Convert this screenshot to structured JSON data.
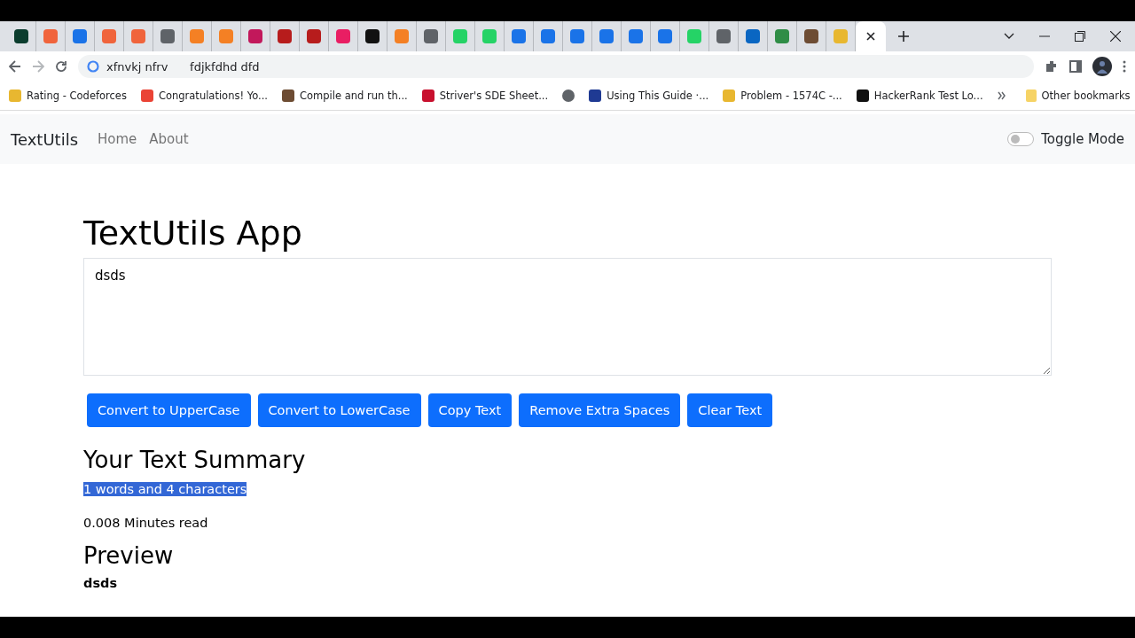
{
  "browser": {
    "tabs": [
      {
        "color": "#0b3d2e",
        "selected": false
      },
      {
        "color": "#f0643c",
        "selected": false
      },
      {
        "color": "#1a73e8",
        "selected": false
      },
      {
        "color": "#f0643c",
        "selected": false
      },
      {
        "color": "#f0643c",
        "selected": false
      },
      {
        "color": "#5f6368",
        "selected": false
      },
      {
        "color": "#f48024",
        "selected": false
      },
      {
        "color": "#f48024",
        "selected": false
      },
      {
        "color": "#c2185b",
        "selected": false
      },
      {
        "color": "#b71c1c",
        "selected": false
      },
      {
        "color": "#b71c1c",
        "selected": false
      },
      {
        "color": "#e91e63",
        "selected": false
      },
      {
        "color": "#111111",
        "selected": false
      },
      {
        "color": "#f48024",
        "selected": false
      },
      {
        "color": "#5f6368",
        "selected": false
      },
      {
        "color": "#25d366",
        "selected": false
      },
      {
        "color": "#25d366",
        "selected": false
      },
      {
        "color": "#1a73e8",
        "selected": false
      },
      {
        "color": "#1a73e8",
        "selected": false
      },
      {
        "color": "#1a73e8",
        "selected": false
      },
      {
        "color": "#1a73e8",
        "selected": false
      },
      {
        "color": "#1a73e8",
        "selected": false
      },
      {
        "color": "#1a73e8",
        "selected": false
      },
      {
        "color": "#25d366",
        "selected": false
      },
      {
        "color": "#5f6368",
        "selected": false
      },
      {
        "color": "#0a66c2",
        "selected": false
      },
      {
        "color": "#2f8d46",
        "selected": false
      },
      {
        "color": "#6d4c33",
        "selected": false
      },
      {
        "color": "#e8b730",
        "selected": false
      },
      {
        "selected": true
      }
    ],
    "address": "xfnvkj nfrv      fdjkfdhd dfd",
    "bookmarks": [
      {
        "label": "Rating - Codeforces",
        "color": "#e8b730"
      },
      {
        "label": "Congratulations! Yo...",
        "color": "#ea4335"
      },
      {
        "label": "Compile and run th...",
        "color": "#6d4c33"
      },
      {
        "label": "Striver's SDE Sheet...",
        "color": "#c8102e"
      },
      {
        "color": "#5f6368"
      },
      {
        "label": "Using This Guide ·...",
        "color": "#1f3a93"
      },
      {
        "label": "Problem - 1574C -...",
        "color": "#e8b730"
      },
      {
        "label": "HackerRank Test Lo...",
        "color": "#111111"
      }
    ],
    "other_bookmarks": "Other bookmarks"
  },
  "navbar": {
    "brand": "TextUtils",
    "links": [
      "Home",
      "About"
    ],
    "toggle": {
      "label": "Toggle Mode",
      "on": false
    }
  },
  "heading": "TextUtils App",
  "textarea": {
    "value": "dsds"
  },
  "buttons": [
    "Convert to UpperCase",
    "Convert to LowerCase",
    "Copy Text",
    "Remove Extra Spaces",
    "Clear Text"
  ],
  "summary": {
    "title": "Your Text Summary",
    "counts": {
      "text": "1 words and 4 characters",
      "selected": true
    },
    "read_time": "0.008 Minutes read"
  },
  "preview": {
    "title": "Preview",
    "text": "dsds"
  }
}
